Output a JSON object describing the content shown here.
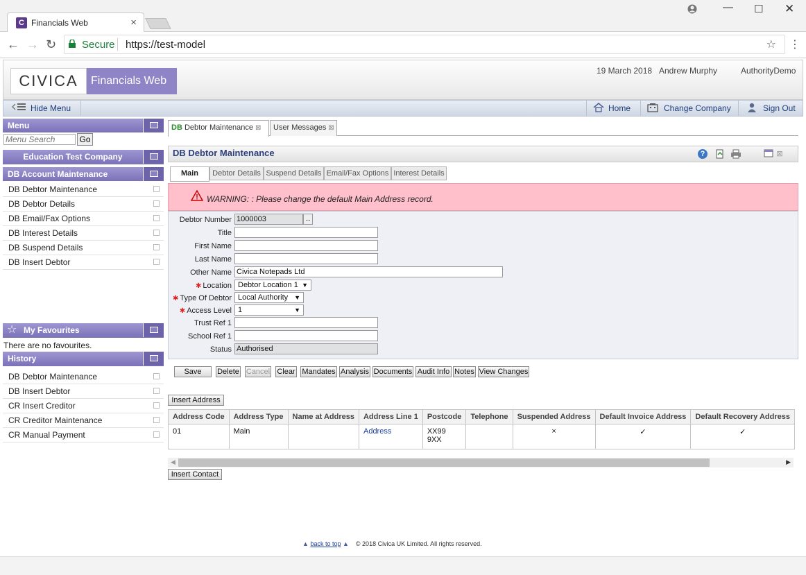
{
  "browser": {
    "tab_title": "Financials Web",
    "favicon_letter": "C",
    "secure_label": "Secure",
    "url": "https://test-model"
  },
  "header": {
    "logo": "CIVICA",
    "app_title": "Financials Web",
    "date": "19 March 2018",
    "user": "Andrew Murphy",
    "authority": "AuthorityDemo"
  },
  "toolbar": {
    "hide_menu": "Hide Menu",
    "home": "Home",
    "change_company": "Change Company",
    "sign_out": "Sign Out"
  },
  "sidebar": {
    "menu_title": "Menu",
    "search_placeholder": "Menu Search",
    "go_label": "Go",
    "company": "Education Test Company",
    "section_title": "DB Account Maintenance",
    "items": [
      "DB Debtor Maintenance",
      "DB Debtor Details",
      "DB Email/Fax Options",
      "DB Interest Details",
      "DB Suspend Details",
      "DB Insert Debtor"
    ],
    "favourites_title": "My Favourites",
    "favourites_empty": "There are no favourites.",
    "history_title": "History",
    "history": [
      "DB Debtor Maintenance",
      "DB Insert Debtor",
      "CR Insert Creditor",
      "CR Creditor Maintenance",
      "CR Manual Payment"
    ]
  },
  "content_tabs": [
    {
      "prefix": "DB",
      "label": "Debtor Maintenance"
    },
    {
      "label": "User Messages"
    }
  ],
  "panel": {
    "title": "DB Debtor Maintenance",
    "sub_tabs": [
      "Main",
      "Debtor Details",
      "Suspend Details",
      "Email/Fax Options",
      "Interest Details"
    ],
    "warning": "WARNING: : Please change the default Main Address record."
  },
  "form": {
    "debtor_number_label": "Debtor Number",
    "debtor_number": "1000003",
    "title_label": "Title",
    "title": "",
    "first_name_label": "First Name",
    "first_name": "",
    "last_name_label": "Last Name",
    "last_name": "",
    "other_name_label": "Other Name",
    "other_name": "Civica Notepads Ltd",
    "location_label": "Location",
    "location": "Debtor Location 1",
    "type_label": "Type Of Debtor",
    "type": "Local Authority",
    "access_label": "Access Level",
    "access": "1",
    "trust_ref_label": "Trust Ref 1",
    "trust_ref": "",
    "school_ref_label": "School Ref 1",
    "school_ref": "",
    "status_label": "Status",
    "status": "Authorised"
  },
  "actions": {
    "save": "Save",
    "delete": "Delete",
    "cancel": "Cancel",
    "clear": "Clear",
    "mandates": "Mandates",
    "analysis": "Analysis",
    "documents": "Documents",
    "audit_info": "Audit Info",
    "notes": "Notes",
    "view_changes": "View Changes",
    "insert_address": "Insert Address",
    "insert_contact": "Insert Contact"
  },
  "address_table": {
    "columns": [
      "Address Code",
      "Address Type",
      "Name at Address",
      "Address Line 1",
      "Postcode",
      "Telephone",
      "Suspended Address",
      "Default Invoice Address",
      "Default Recovery Address"
    ],
    "rows": [
      {
        "code": "01",
        "type": "Main",
        "name": "",
        "line1": "Address",
        "postcode_1": "XX99",
        "postcode_2": "9XX",
        "telephone": "",
        "suspended": "×",
        "default_invoice": "✓",
        "default_recovery": "✓"
      }
    ]
  },
  "footer": {
    "back_to_top": "back to top",
    "copyright": "© 2018 Civica UK Limited. All rights reserved."
  }
}
